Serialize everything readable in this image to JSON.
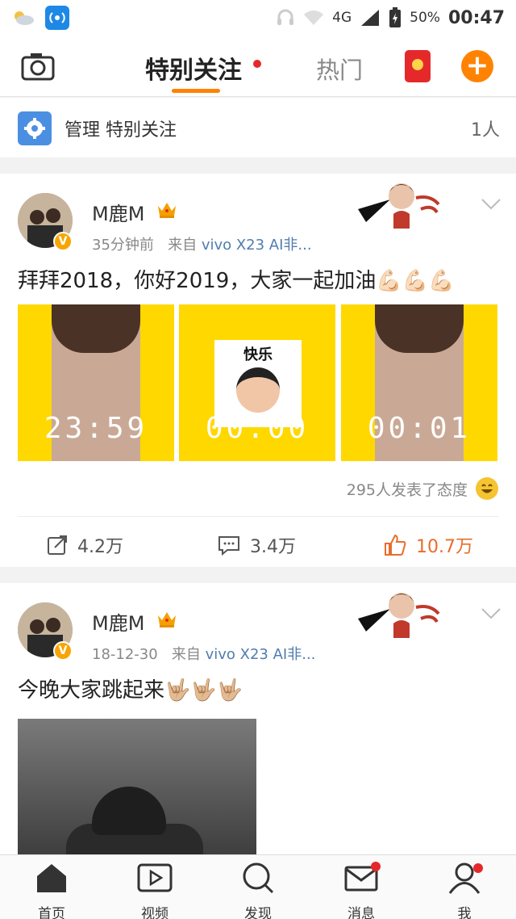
{
  "status_bar": {
    "network": "4G",
    "battery": "50%",
    "time": "00:47"
  },
  "top_nav": {
    "tab_special": "特别关注",
    "tab_hot": "热门",
    "accent_color": "#ff8200"
  },
  "manage_bar": {
    "label": "管理 特别关注",
    "count": "1人"
  },
  "posts": [
    {
      "username": "M鹿M",
      "time": "35分钟前",
      "from_label": "来自",
      "source": "vivo X23 AI非...",
      "text": "拜拜2018，你好2019，大家一起加油💪🏻💪🏻💪🏻",
      "images": [
        {
          "overlay": "23:59"
        },
        {
          "sticker_label": "快乐",
          "overlay": "00:00"
        },
        {
          "overlay": "00:01"
        }
      ],
      "reactions": "295人发表了态度",
      "share_count": "4.2万",
      "comment_count": "3.4万",
      "like_count": "10.7万"
    },
    {
      "username": "M鹿M",
      "time": "18-12-30",
      "from_label": "来自",
      "source": "vivo X23 AI非...",
      "text": "今晚大家跳起来🤟🏼🤟🏼🤟🏼"
    }
  ],
  "bottom_nav": {
    "home": "首页",
    "video": "视频",
    "discover": "发现",
    "messages": "消息",
    "me": "我"
  }
}
